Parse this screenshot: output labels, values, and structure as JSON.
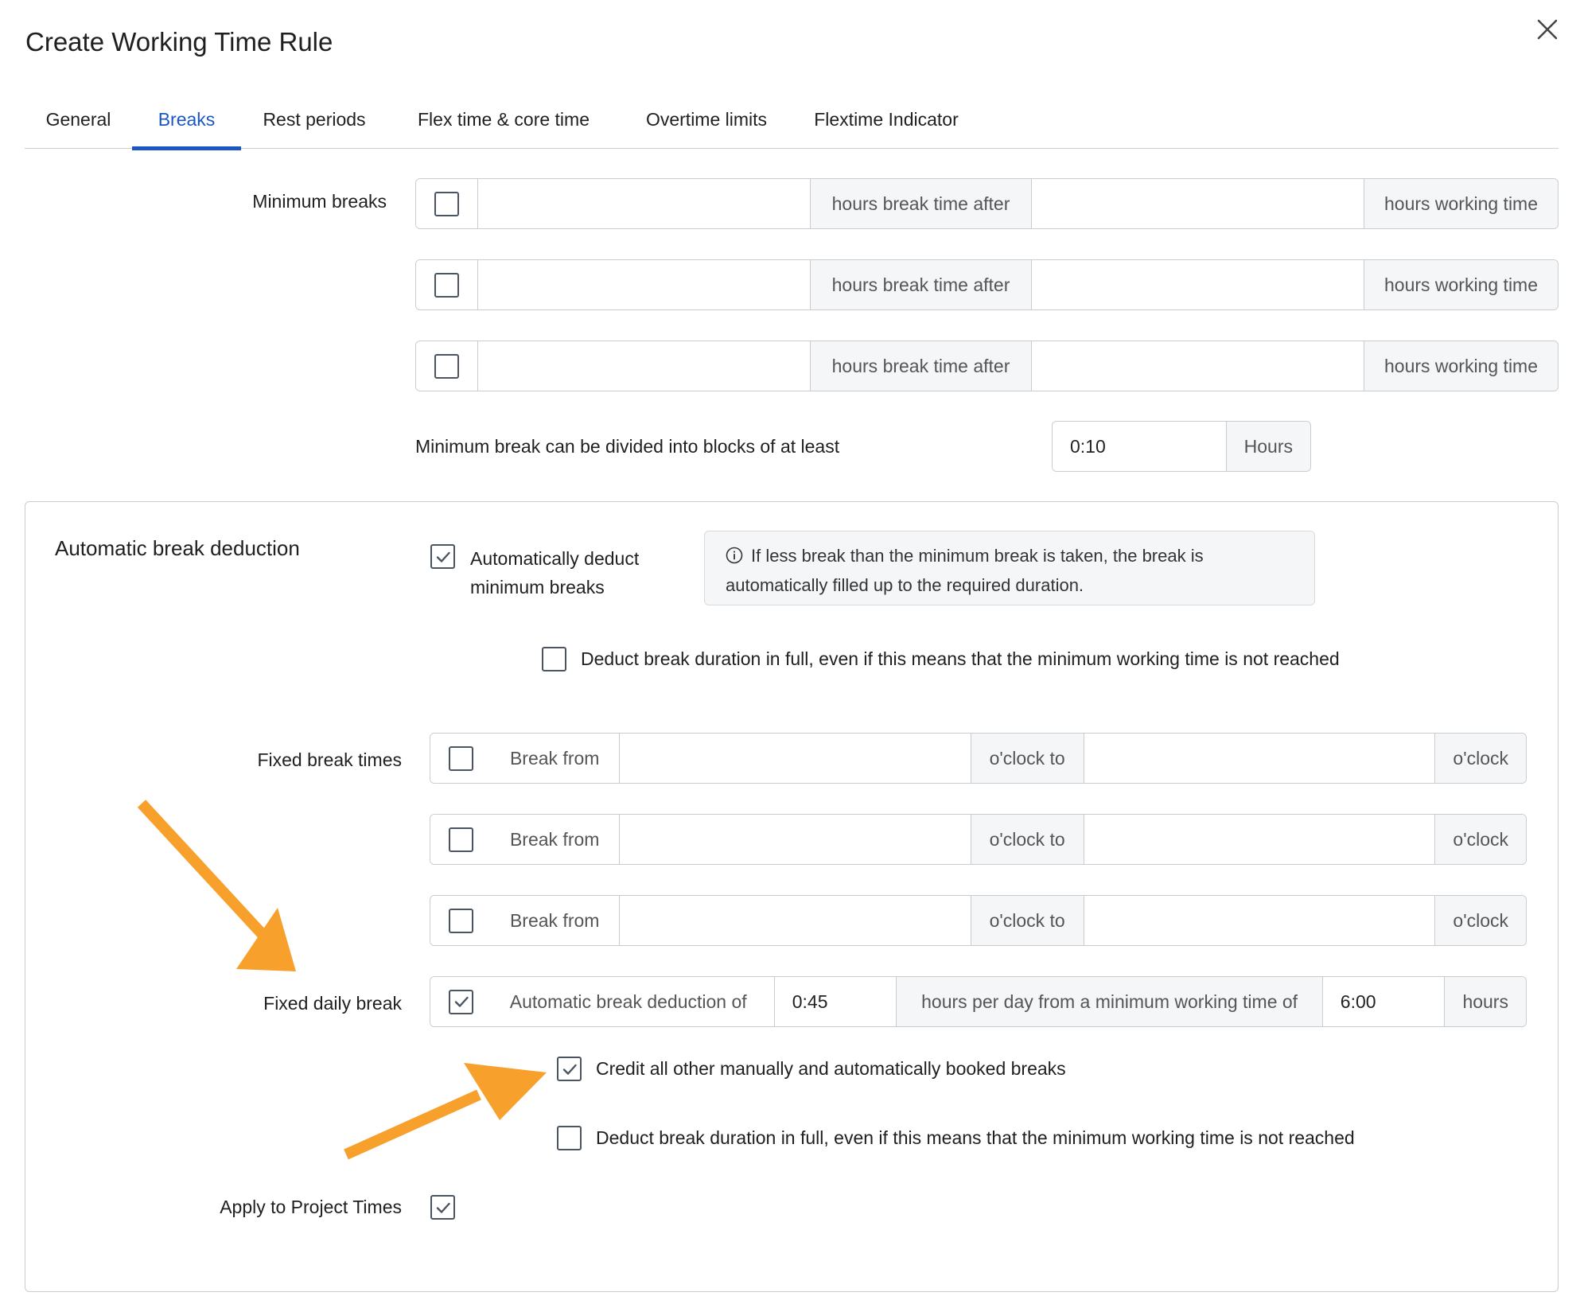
{
  "dialog": {
    "title": "Create Working Time Rule"
  },
  "tabs": [
    {
      "label": "General"
    },
    {
      "label": "Breaks"
    },
    {
      "label": "Rest periods"
    },
    {
      "label": "Flex time & core time"
    },
    {
      "label": "Overtime limits"
    },
    {
      "label": "Flextime Indicator"
    }
  ],
  "active_tab": "Breaks",
  "minimum_breaks": {
    "label": "Minimum breaks",
    "rows": [
      {
        "checked": false,
        "break_value": "",
        "mid_text": "hours break time after",
        "work_value": "",
        "end_text": "hours working time"
      },
      {
        "checked": false,
        "break_value": "",
        "mid_text": "hours break time after",
        "work_value": "",
        "end_text": "hours working time"
      },
      {
        "checked": false,
        "break_value": "",
        "mid_text": "hours break time after",
        "work_value": "",
        "end_text": "hours working time"
      }
    ],
    "divide_label": "Minimum break can be divided into blocks of at least",
    "divide_value": "0:10",
    "divide_unit": "Hours"
  },
  "auto_deduction": {
    "label": "Automatic break deduction",
    "auto_checkbox": {
      "checked": true,
      "label_line1": "Automatically deduct",
      "label_line2": "minimum breaks"
    },
    "info_line1": "If less break than the minimum break is taken, the break is",
    "info_line2": "automatically filled up to the required duration.",
    "full_checkbox": {
      "checked": false,
      "label": "Deduct break duration in full, even if this means that the minimum working time is not reached"
    }
  },
  "fixed_break_times": {
    "label": "Fixed break times",
    "rows": [
      {
        "checked": false,
        "from_text": "Break from",
        "from_value": "",
        "to_text": "o'clock to",
        "to_value": "",
        "end_text": "o'clock"
      },
      {
        "checked": false,
        "from_text": "Break from",
        "from_value": "",
        "to_text": "o'clock to",
        "to_value": "",
        "end_text": "o'clock"
      },
      {
        "checked": false,
        "from_text": "Break from",
        "from_value": "",
        "to_text": "o'clock to",
        "to_value": "",
        "end_text": "o'clock"
      }
    ]
  },
  "fixed_daily_break": {
    "label": "Fixed daily break",
    "checked": true,
    "prefix": "Automatic break deduction of",
    "duration": "0:45",
    "mid_text": "hours per day from a minimum working time of",
    "min_work": "6:00",
    "unit": "hours",
    "credit_checkbox": {
      "checked": true,
      "label": "Credit all other manually and automatically booked breaks"
    },
    "full_checkbox": {
      "checked": false,
      "label": "Deduct break duration in full, even if this means that the minimum working time is not reached"
    }
  },
  "apply_project_times": {
    "label": "Apply to Project Times",
    "checked": true
  },
  "colors": {
    "accent": "#1a56c4",
    "arrow": "#f7a02b",
    "border": "#c9ccd1",
    "addon_bg": "#f5f6f7"
  },
  "icons": {
    "close": "close-icon",
    "check": "check-icon",
    "info": "info-icon",
    "arrow": "arrow-annotation"
  }
}
